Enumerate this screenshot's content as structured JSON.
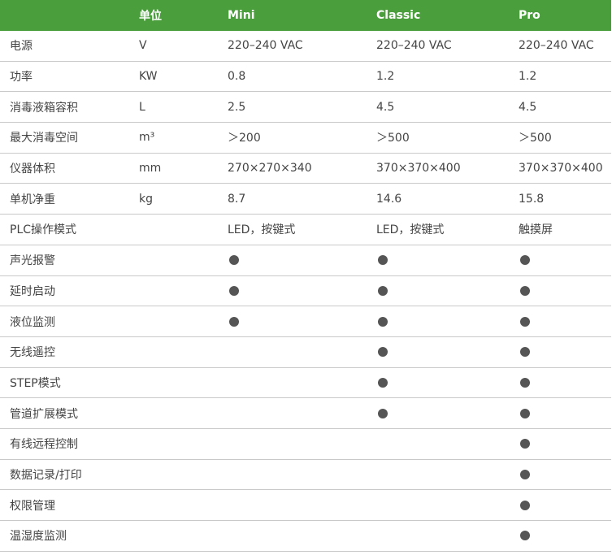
{
  "header": {
    "label": "",
    "unit": "单位",
    "mini": "Mini",
    "classic": "Classic",
    "pro": "Pro"
  },
  "rows": [
    {
      "label": "电源",
      "unit": "V",
      "mini": "220–240 VAC",
      "classic": "220–240 VAC",
      "pro": "220–240 VAC"
    },
    {
      "label": "功率",
      "unit": "KW",
      "mini": "0.8",
      "classic": "1.2",
      "pro": "1.2"
    },
    {
      "label": "消毒液箱容积",
      "unit": "L",
      "mini": "2.5",
      "classic": "4.5",
      "pro": "4.5"
    },
    {
      "label": "最大消毒空间",
      "unit": "m³",
      "mini": "＞200",
      "classic": "＞500",
      "pro": "＞500"
    },
    {
      "label": "仪器体积",
      "unit": "mm",
      "mini": "270×270×340",
      "classic": "370×370×400",
      "pro": "370×370×400"
    },
    {
      "label": "单机净重",
      "unit": "kg",
      "mini": "8.7",
      "classic": "14.6",
      "pro": "15.8"
    },
    {
      "label": "PLC操作模式",
      "unit": "",
      "mini": "LED，按键式",
      "classic": "LED，按键式",
      "pro": "触摸屏"
    },
    {
      "label": "声光报警",
      "unit": "",
      "mini": true,
      "classic": true,
      "pro": true
    },
    {
      "label": "延时启动",
      "unit": "",
      "mini": true,
      "classic": true,
      "pro": true
    },
    {
      "label": "液位监测",
      "unit": "",
      "mini": true,
      "classic": true,
      "pro": true
    },
    {
      "label": "无线遥控",
      "unit": "",
      "mini": false,
      "classic": true,
      "pro": true
    },
    {
      "label": "STEP模式",
      "unit": "",
      "mini": false,
      "classic": true,
      "pro": true
    },
    {
      "label": "管道扩展模式",
      "unit": "",
      "mini": false,
      "classic": true,
      "pro": true
    },
    {
      "label": "有线远程控制",
      "unit": "",
      "mini": false,
      "classic": false,
      "pro": true
    },
    {
      "label": "数据记录/打印",
      "unit": "",
      "mini": false,
      "classic": false,
      "pro": true
    },
    {
      "label": "权限管理",
      "unit": "",
      "mini": false,
      "classic": false,
      "pro": true
    },
    {
      "label": "温湿度监测",
      "unit": "",
      "mini": false,
      "classic": false,
      "pro": true
    }
  ],
  "colors": {
    "header_bg": "#4a9e3b",
    "header_text": "#ffffff",
    "body_text": "#444444",
    "dot": "#555555",
    "divider": "#c9c9c9"
  }
}
